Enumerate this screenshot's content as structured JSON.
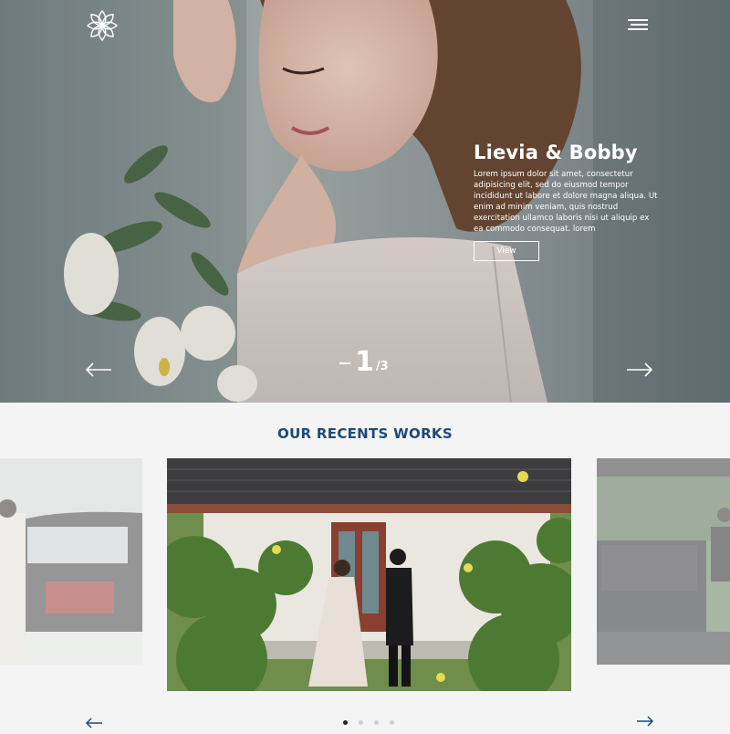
{
  "colors": {
    "accent": "#1d4a78",
    "background": "#f4f4f4"
  },
  "header": {
    "logo_icon": "lotus-logo-icon",
    "menu_icon": "hamburger-menu-icon"
  },
  "hero": {
    "title": "Lievia & Bobby",
    "description": "Lorem ipsum dolor sit amet, consectetur adipisicing elit, sed do eiusmod tempor incididunt ut labore et dolore magna aliqua. Ut enim ad minim veniam, quis nostrud exercitation ullamco laboris nisi ut aliquip ex ea commodo consequat. lorem",
    "button_label": "View",
    "slide_current": "1",
    "slide_total": "/3",
    "prev_icon": "arrow-left-icon",
    "next_icon": "arrow-right-icon"
  },
  "works": {
    "title": "OUR RECENTS WORKS",
    "slides": [
      {
        "name": "bride-by-car"
      },
      {
        "name": "couple-in-garden"
      },
      {
        "name": "vintage-carriage"
      }
    ],
    "dots": 4,
    "active_dot": 1,
    "prev_icon": "arrow-left-icon",
    "next_icon": "arrow-right-icon"
  }
}
